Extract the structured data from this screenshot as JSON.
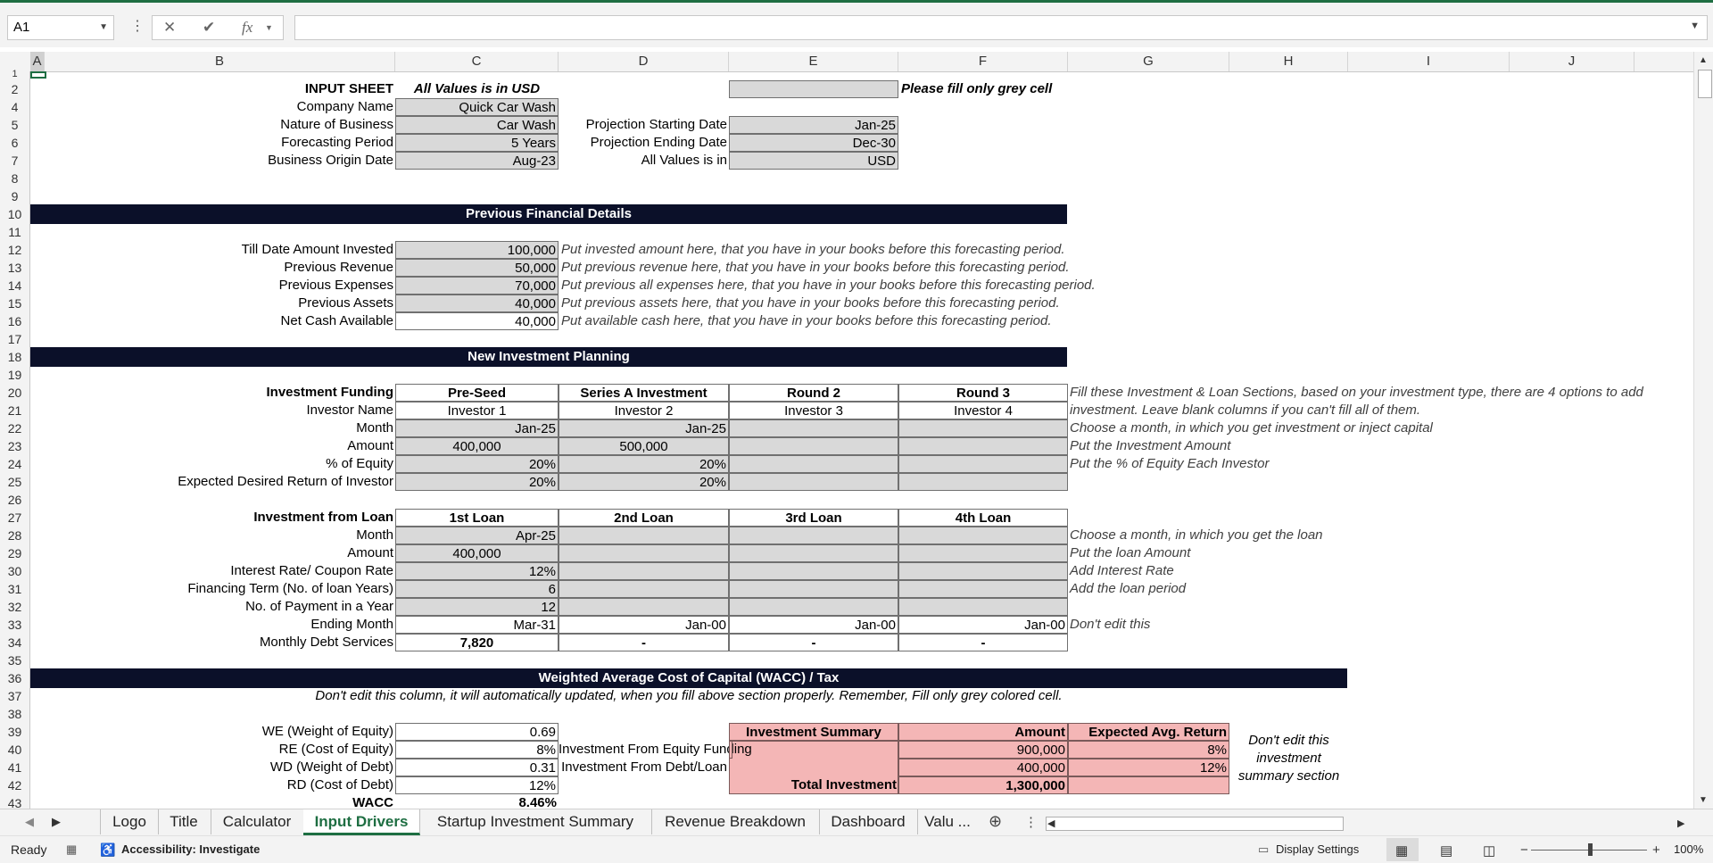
{
  "formula_bar": {
    "name_box": "A1",
    "fx_label": "fx",
    "cancel_icon": "✕",
    "enter_icon": "✔",
    "formula": ""
  },
  "columns": [
    "A",
    "B",
    "C",
    "D",
    "E",
    "F",
    "G",
    "H",
    "I",
    "J"
  ],
  "rows": [
    "1",
    "2",
    "4",
    "5",
    "6",
    "7",
    "8",
    "9",
    "10",
    "11",
    "12",
    "13",
    "14",
    "15",
    "16",
    "17",
    "18",
    "19",
    "20",
    "21",
    "22",
    "23",
    "24",
    "25",
    "26",
    "27",
    "28",
    "29",
    "30",
    "31",
    "32",
    "33",
    "34",
    "35",
    "36",
    "37",
    "38",
    "39",
    "40",
    "41",
    "42",
    "43"
  ],
  "header": {
    "input_sheet": "INPUT SHEET",
    "values_note": "All Values is in USD",
    "fill_note": "Please fill only grey cell"
  },
  "company": {
    "labels": [
      "Company Name",
      "Nature of Business",
      "Forecasting Period",
      "Business Origin Date"
    ],
    "values": [
      "Quick Car Wash",
      "Car Wash",
      "5 Years",
      "Aug-23"
    ]
  },
  "projection": {
    "labels": [
      "Projection Starting Date",
      "Projection Ending Date",
      "All Values is in"
    ],
    "values": [
      "Jan-25",
      "Dec-30",
      "USD"
    ]
  },
  "sections": {
    "previous": "Previous Financial Details",
    "new_investment": "New Investment Planning",
    "wacc": "Weighted Average Cost of Capital (WACC) / Tax"
  },
  "previous_financials": {
    "labels": [
      "Till Date Amount Invested",
      "Previous Revenue",
      "Previous Expenses",
      "Previous Assets",
      "Net Cash Available"
    ],
    "values": [
      "100,000",
      "50,000",
      "70,000",
      "40,000",
      "40,000"
    ],
    "notes": [
      "Put invested amount here, that you have in your books before this forecasting period.",
      "Put previous revenue here, that you have in your books before this forecasting period.",
      "Put previous all expenses here, that you have in your books before this forecasting period.",
      "Put previous assets here, that you have in your books before this forecasting period.",
      "Put available cash here, that you have in your books before this forecasting period."
    ]
  },
  "investment_funding": {
    "title": "Investment Funding",
    "rounds": [
      "Pre-Seed",
      "Series A Investment",
      "Round 2",
      "Round 3"
    ],
    "labels": [
      "Investor Name",
      "Month",
      "Amount",
      "% of Equity",
      "Expected Desired Return of Investor"
    ],
    "investors": [
      "Investor 1",
      "Investor 2",
      "Investor 3",
      "Investor 4"
    ],
    "months": [
      "Jan-25",
      "Jan-25",
      "",
      ""
    ],
    "amounts": [
      "400,000",
      "500,000",
      "",
      ""
    ],
    "equity": [
      "20%",
      "20%",
      "",
      ""
    ],
    "returns": [
      "20%",
      "20%",
      "",
      ""
    ],
    "notes": [
      "Fill these Investment & Loan Sections, based on your investment type, there are 4 options to add",
      "investment. Leave blank columns if you can't fill all of them.",
      "Choose a month, in which you get investment or inject capital",
      "Put the Investment Amount",
      "Put the % of Equity Each Investor"
    ]
  },
  "loans": {
    "title": "Investment from Loan",
    "headers": [
      "1st Loan",
      "2nd Loan",
      "3rd Loan",
      "4th Loan"
    ],
    "labels": [
      "Month",
      "Amount",
      "Interest Rate/ Coupon Rate",
      "Financing Term (No. of loan Years)",
      "No. of Payment in a Year",
      "Ending Month",
      "Monthly Debt Services"
    ],
    "month": [
      "Apr-25",
      "",
      "",
      ""
    ],
    "amount": [
      "400,000",
      "",
      "",
      ""
    ],
    "rate": [
      "12%",
      "",
      "",
      ""
    ],
    "term": [
      "6",
      "",
      "",
      ""
    ],
    "payments": [
      "12",
      "",
      "",
      ""
    ],
    "ending": [
      "Mar-31",
      "Jan-00",
      "Jan-00",
      "Jan-00"
    ],
    "debt_service": [
      "7,820",
      "-",
      "-",
      "-"
    ],
    "notes": [
      "Choose a month, in which you get the loan",
      "Put the loan Amount",
      "Add Interest Rate",
      "Add the loan period",
      "",
      "Don't edit this"
    ]
  },
  "wacc": {
    "note": "Don't edit this column, it will automatically updated, when you fill above section properly. Remember, Fill only grey colored cell.",
    "labels": [
      "WE (Weight of Equity)",
      "RE (Cost of Equity)",
      "WD (Weight of Debt)",
      "RD (Cost of Debt)",
      "WACC"
    ],
    "values": [
      "0.69",
      "8%",
      "0.31",
      "12%",
      "8.46%"
    ]
  },
  "investment_summary": {
    "headers": [
      "Investment Summary",
      "Amount",
      "Expected Avg. Return"
    ],
    "rows": [
      [
        "Investment From Equity Funding",
        "900,000",
        "8%"
      ],
      [
        "Investment From Debt/Loan",
        "400,000",
        "12%"
      ],
      [
        "Total Investment",
        "1,300,000",
        ""
      ]
    ],
    "side_note": [
      "Don't edit this",
      "investment",
      "summary section"
    ]
  },
  "sheet_tabs": [
    "Logo",
    "Title",
    "Calculator",
    "Input Drivers",
    "Startup Investment Summary",
    "Revenue Breakdown",
    "Dashboard",
    "Valu ..."
  ],
  "active_tab": "Input Drivers",
  "status_bar": {
    "ready": "Ready",
    "accessibility": "Accessibility: Investigate",
    "display_settings": "Display Settings",
    "zoom": "100%"
  },
  "colors": {
    "band": "#0b1029",
    "grey_cell": "#d9d9d9",
    "pink_cell": "#f4b6b6",
    "excel_green": "#1e6e42"
  }
}
